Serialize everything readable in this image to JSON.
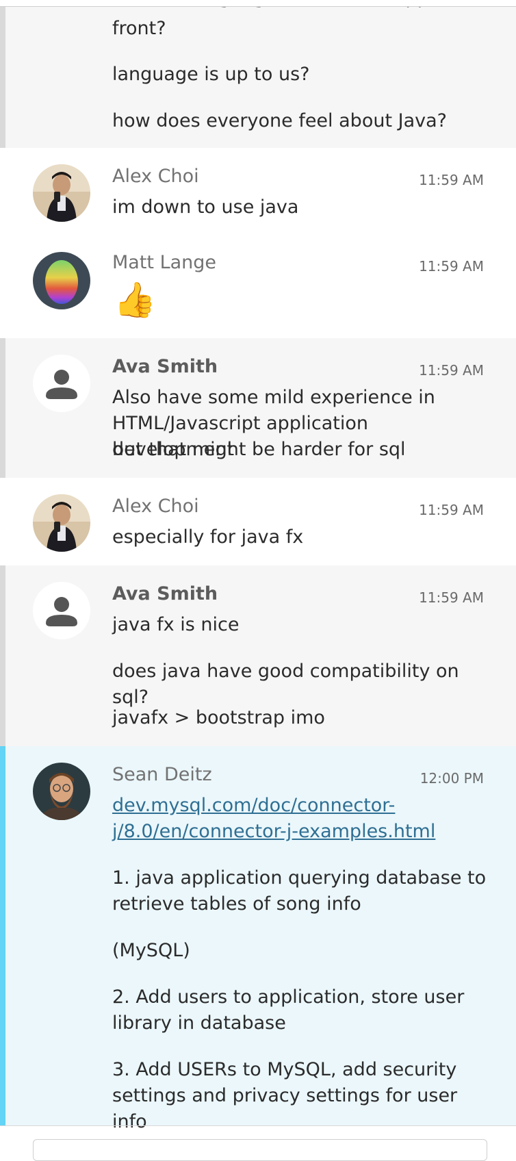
{
  "messages": [
    {
      "author": "",
      "time": "",
      "lines": [
        "another language to build the application",
        "front?",
        "language is up to us?",
        "how does everyone feel about Java?"
      ]
    },
    {
      "author": "Alex Choi",
      "time": "11:59 AM",
      "lines": [
        "im down to use java"
      ]
    },
    {
      "author": "Matt Lange",
      "time": "11:59 AM",
      "lines": [
        "👍"
      ]
    },
    {
      "author": "Ava Smith",
      "time": "11:59 AM",
      "lines": [
        "Also have some mild experience in",
        "HTML/Javascript application development",
        "but that might be harder for sql"
      ]
    },
    {
      "author": "Alex Choi",
      "time": "11:59 AM",
      "lines": [
        "especially for java fx"
      ]
    },
    {
      "author": "Ava Smith",
      "time": "11:59 AM",
      "lines": [
        "java fx is nice",
        "does java have good compatibility on sql?",
        "javafx > bootstrap imo"
      ]
    },
    {
      "author": "Sean Deitz",
      "time": "12:00 PM",
      "link": [
        "dev.mysql.com/doc/connector-",
        "j/8.0/en/connector-j-examples.html"
      ],
      "lines": [
        "1. java application querying database to",
        "retrieve tables of song info",
        "(MySQL)",
        "2. Add users to application, store user",
        "library in database",
        "3. Add USERs to MySQL, add security",
        "settings and privacy settings for user info"
      ]
    }
  ],
  "colors": {
    "highlight_bar": "#63d3f6",
    "highlight_bg": "#ebf7fb",
    "grey_bg": "#f6f6f6",
    "link": "#2f6f93"
  },
  "icons": {
    "reaction": "thumbs-up-emoji",
    "default_avatar": "person-icon"
  }
}
